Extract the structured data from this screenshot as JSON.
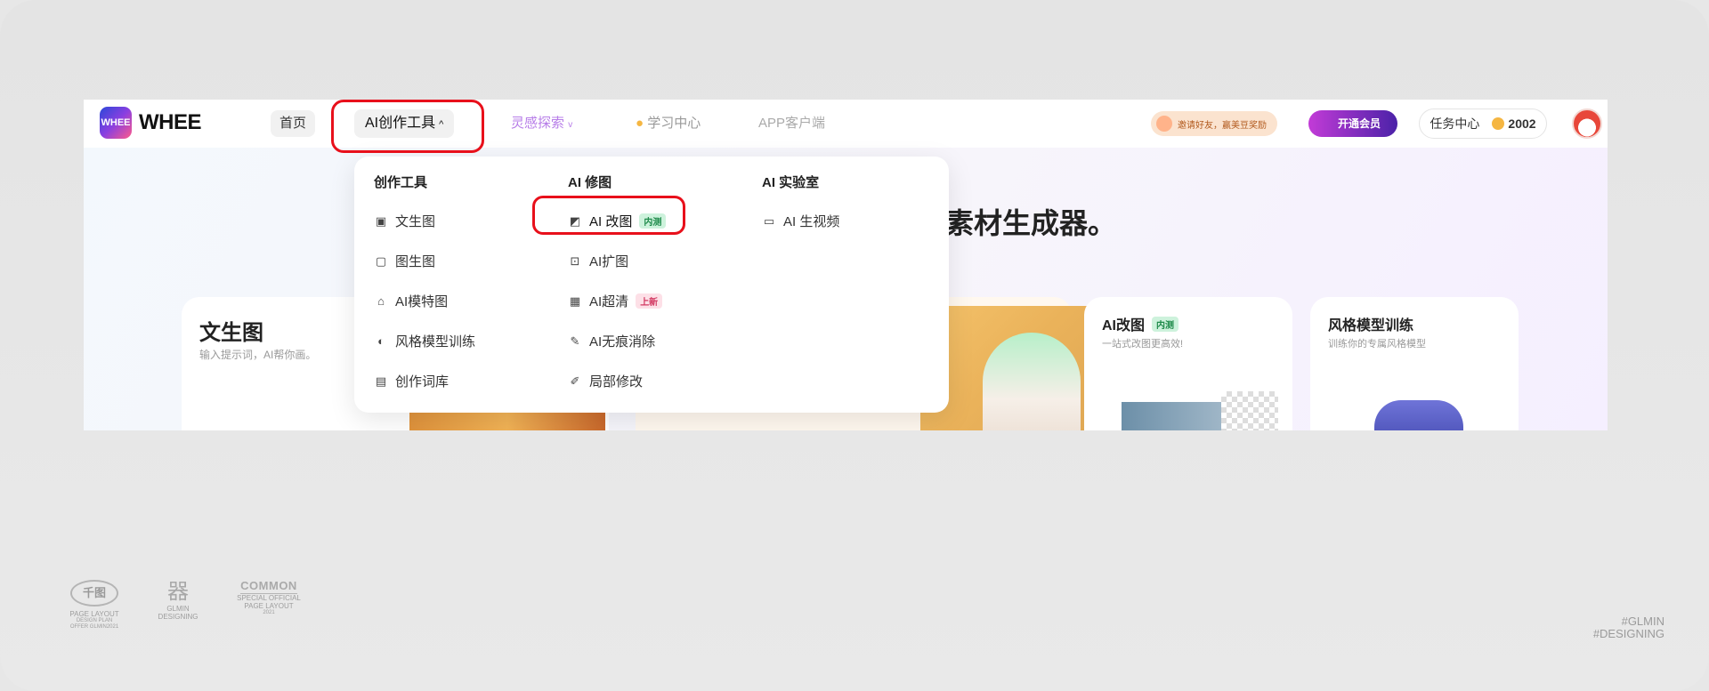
{
  "brand": {
    "logo_text": "WHEE",
    "logo_mark_text": "WHEE"
  },
  "nav": {
    "home": "首页",
    "ai_tools": "AI创作工具",
    "ai_tools_chevron": "^",
    "explore": "灵感探索",
    "explore_chevron": "v",
    "learn": "学习中心",
    "app": "APP客户端"
  },
  "header_right": {
    "promo": "邀请好友，赢美豆奖励",
    "vip": "开通会员",
    "task_center": "任务中心",
    "coins": "2002"
  },
  "hero": {
    "title_fragment": "素材生成器。"
  },
  "cards": [
    {
      "title": "文生图",
      "subtitle": "输入提示词，AI帮你画。"
    },
    {
      "title": "AI改图",
      "tag": "内测",
      "subtitle": "一站式改图更高效!"
    },
    {
      "title": "风格模型训练",
      "subtitle": "训练你的专属风格模型"
    }
  ],
  "dropdown": {
    "columns": [
      {
        "heading": "创作工具",
        "items": [
          {
            "label": "文生图",
            "icon": "image-text-icon"
          },
          {
            "label": "图生图",
            "icon": "image-to-image-icon"
          },
          {
            "label": "AI模特图",
            "icon": "model-figure-icon"
          },
          {
            "label": "风格模型训练",
            "icon": "palette-icon"
          },
          {
            "label": "创作词库",
            "icon": "book-icon"
          }
        ]
      },
      {
        "heading": "AI 修图",
        "items": [
          {
            "label": "AI 改图",
            "icon": "edit-image-icon",
            "tag": "内测"
          },
          {
            "label": "AI扩图",
            "icon": "expand-icon"
          },
          {
            "label": "AI超清",
            "icon": "hd-icon",
            "tag": "上新"
          },
          {
            "label": "AI无痕消除",
            "icon": "eraser-icon"
          },
          {
            "label": "局部修改",
            "icon": "brush-icon"
          }
        ]
      },
      {
        "heading": "AI 实验室",
        "items": [
          {
            "label": "AI 生视频",
            "icon": "video-icon"
          }
        ]
      }
    ]
  },
  "footer": {
    "mark1_badge": "千图",
    "mark1_line1": "PAGE LAYOUT",
    "mark1_line2": "DESIGN PLAN",
    "mark1_line3": "OFFER GLMIN2021",
    "mark2_glyph": "器",
    "mark2_line1": "GLMIN",
    "mark2_line2": "DESIGNING",
    "mark3_title": "COMMON",
    "mark3_line1": "SPECIAL OFFICIAL",
    "mark3_line2": "PAGE LAYOUT",
    "mark3_line3": "2021",
    "right_line1": "#GLMIN",
    "right_line2": "#DESIGNING"
  },
  "colors": {
    "highlight": "#e8101b",
    "explore_accent": "#b77de8",
    "vip_gradient_start": "#c23bd7",
    "vip_gradient_end": "#4b22a8"
  }
}
